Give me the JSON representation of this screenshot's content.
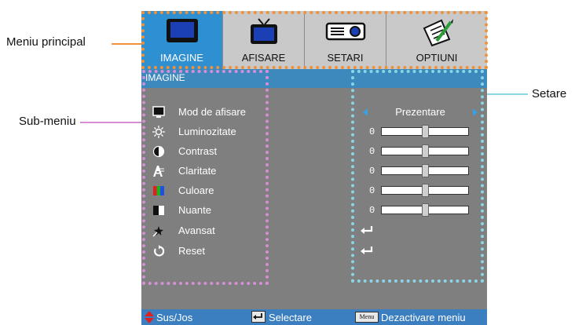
{
  "callouts": {
    "main_menu": "Meniu principal",
    "sub_menu": "Sub-meniu",
    "setting": "Setare"
  },
  "colors": {
    "main_menu_leader": "#f0923a",
    "sub_menu_leader": "#d68fd6",
    "setting_leader": "#8ad6e6",
    "active_tab": "#2e8fd1",
    "header_bar": "#3d89be",
    "panel_bg": "#7f7f7f"
  },
  "tabs": [
    {
      "label": "IMAGINE",
      "icon": "monitor-icon",
      "active": true
    },
    {
      "label": "AFISARE",
      "icon": "tv-icon",
      "active": false
    },
    {
      "label": "SETARI",
      "icon": "projector-icon",
      "active": false
    },
    {
      "label": "OPTIUNI",
      "icon": "notepad-icon",
      "active": false
    }
  ],
  "submenu_title": "IMAGINE",
  "items": [
    {
      "label": "Mod de afisare",
      "icon": "display-mode-icon",
      "control": "preset",
      "value": "Prezentare"
    },
    {
      "label": "Luminozitate",
      "icon": "sun-icon",
      "control": "slider",
      "value": "0",
      "level": 0.5
    },
    {
      "label": "Contrast",
      "icon": "contrast-icon",
      "control": "slider",
      "value": "0",
      "level": 0.5
    },
    {
      "label": "Claritate",
      "icon": "sharpness-icon",
      "control": "slider",
      "value": "0",
      "level": 0.5
    },
    {
      "label": "Culoare",
      "icon": "color-bars-icon",
      "control": "slider",
      "value": "0",
      "level": 0.5
    },
    {
      "label": "Nuante",
      "icon": "tint-icon",
      "control": "slider",
      "value": "0",
      "level": 0.5
    },
    {
      "label": "Avansat",
      "icon": "advanced-icon",
      "control": "enter",
      "value": ""
    },
    {
      "label": "Reset",
      "icon": "reset-icon",
      "control": "enter",
      "value": ""
    }
  ],
  "footer": {
    "updown": "Sus/Jos",
    "select": "Selectare",
    "menu_key": "Menu",
    "exit": "Dezactivare meniu"
  }
}
